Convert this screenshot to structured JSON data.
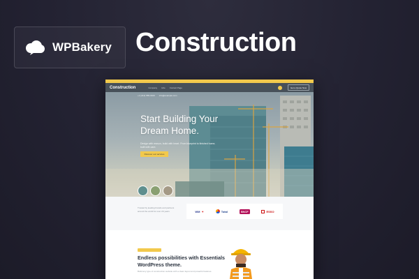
{
  "brand": {
    "name": "WPBakery",
    "icon": "cloud-icon"
  },
  "page_title": "Construction",
  "colors": {
    "background": "#232232",
    "accent_yellow": "#f2c94c",
    "nav_dark": "#475059",
    "heading_dark": "#2c3440"
  },
  "preview": {
    "site": {
      "logo": "Construction",
      "nav_links": [
        "Company",
        "Hire",
        "Contact Page"
      ],
      "cta": "Get a Quote Now"
    },
    "hero": {
      "meta": [
        "+1 (212) 555-0100",
        "info@example.com"
      ],
      "heading": "Start Building Your Dream Home.",
      "subtext": "Design with reason, build with heart. From blueprint to finished home, built with care.",
      "button": "Discover our services"
    },
    "partners": {
      "text": "Trusted by leading brands and partners around the world for over 20 years",
      "logos": [
        "WM",
        "Total",
        "SNCF",
        "ESSO"
      ]
    },
    "feature": {
      "heading": "Endless possibilities with Essentials WordPress theme.",
      "subtext": "Build any type of construction website with a clean layout and powerful features."
    }
  }
}
